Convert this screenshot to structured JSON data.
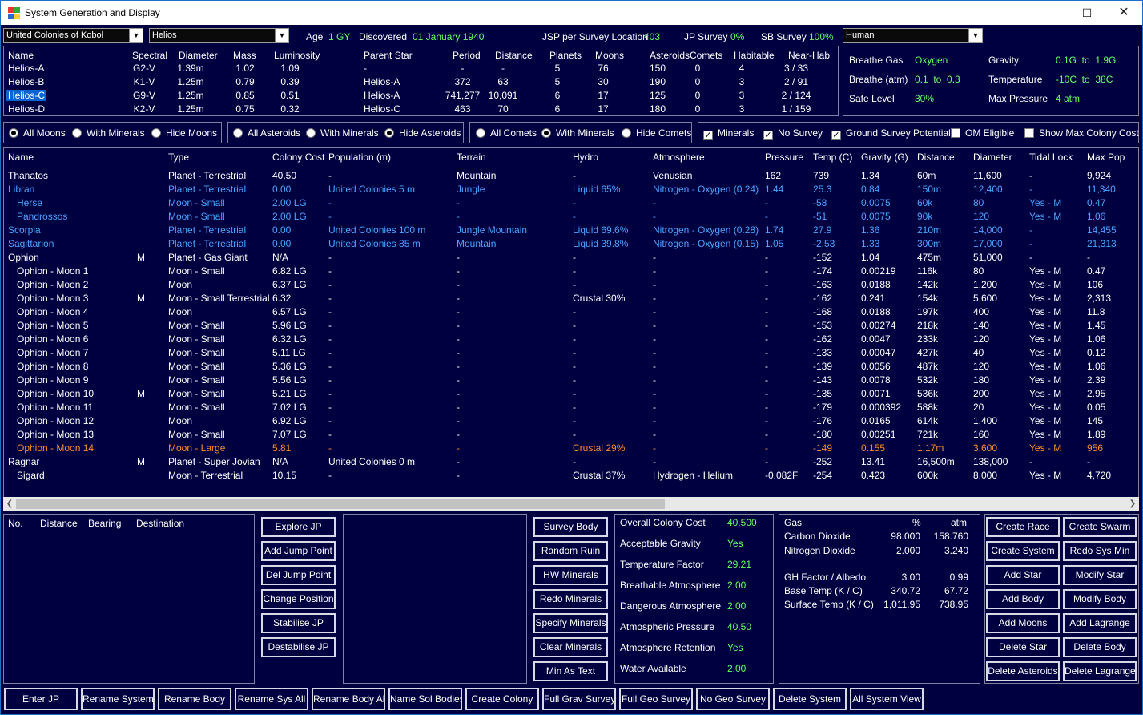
{
  "window": {
    "title": "System Generation and Display"
  },
  "top": {
    "empire": "United Colonies of Kobol",
    "system": "Helios",
    "age_label": "Age",
    "age": "1 GY",
    "discovered_label": "Discovered",
    "discovered": "01 January 1940",
    "jsp_label": "JSP per Survey Location",
    "jsp": "403",
    "jp_label": "JP Survey",
    "jp": "0%",
    "sb_label": "SB Survey",
    "sb": "100%",
    "race": "Human"
  },
  "stars": {
    "headers": [
      "Name",
      "Spectral",
      "Diameter",
      "Mass",
      "Luminosity",
      "Parent Star",
      "Period",
      "Distance",
      "Planets",
      "Moons",
      "Asteroids",
      "Comets",
      "Habitable",
      "Near-Hab"
    ],
    "rows": [
      [
        "Helios-A",
        "G2-V",
        "1.39m",
        "1.02",
        "1.09",
        "-",
        "-",
        "-",
        "5",
        "76",
        "150",
        "0",
        "4",
        "3 / 33"
      ],
      [
        "Helios-B",
        "K1-V",
        "1.25m",
        "0.79",
        "0.39",
        "Helios-A",
        "372",
        "63",
        "5",
        "30",
        "190",
        "0",
        "3",
        "2 / 91"
      ],
      [
        "Helios-C",
        "G9-V",
        "1.25m",
        "0.85",
        "0.51",
        "Helios-A",
        "741,277",
        "10,091",
        "6",
        "17",
        "125",
        "0",
        "3",
        "2 / 124"
      ],
      [
        "Helios-D",
        "K2-V",
        "1.25m",
        "0.75",
        "0.32",
        "Helios-C",
        "463",
        "70",
        "6",
        "17",
        "180",
        "0",
        "3",
        "1 / 159"
      ]
    ],
    "selected": 2
  },
  "env": {
    "breathe_gas_label": "Breathe Gas",
    "breathe_gas": "Oxygen",
    "breathe_atm_label": "Breathe (atm)",
    "breathe_atm": "0.1  to  0.3",
    "safe_label": "Safe Level",
    "safe": "30%",
    "gravity_label": "Gravity",
    "gravity": "0.1G  to  1.9G",
    "temp_label": "Temperature",
    "temp": "-10C  to  38C",
    "maxp_label": "Max Pressure",
    "maxp": "4 atm"
  },
  "filters": {
    "moons": [
      "All Moons",
      "With Minerals",
      "Hide Moons"
    ],
    "asteroids": [
      "All Asteroids",
      "With Minerals",
      "Hide Asteroids"
    ],
    "comets": [
      "All Comets",
      "With Minerals",
      "Hide Comets"
    ],
    "checks": [
      "Minerals",
      "No Survey",
      "Ground Survey Potential",
      "OM Eligible",
      "Show Max Colony Cost"
    ]
  },
  "bodies": {
    "headers": [
      "Name",
      "Type",
      "Colony Cost",
      "Population (m)",
      "Terrain",
      "Hydro",
      "Atmosphere",
      "Pressure",
      "Temp (C)",
      "Gravity (G)",
      "Distance",
      "Diameter",
      "Tidal Lock",
      "Max Pop"
    ],
    "rows": [
      {
        "n": "Thanatos",
        "i": 0,
        "m": "",
        "c": "",
        "v": [
          "Planet - Terrestrial",
          "40.50",
          "-",
          "Mountain",
          "-",
          "Venusian",
          "162",
          "739",
          "1.34",
          "60m",
          "11,600",
          "-",
          "9,924"
        ]
      },
      {
        "n": "Libran",
        "i": 0,
        "m": "",
        "c": "blue",
        "v": [
          "Planet - Terrestrial",
          "0.00",
          "United Colonies 5 m",
          "Jungle",
          "Liquid 65%",
          "Nitrogen - Oxygen (0.24)",
          "1.44",
          "25.3",
          "0.84",
          "150m",
          "12,400",
          "-",
          "11,340"
        ]
      },
      {
        "n": "Herse",
        "i": 1,
        "m": "",
        "c": "blue",
        "v": [
          "Moon - Small",
          "2.00 LG",
          "-",
          "-",
          "-",
          "-",
          "-",
          "-58",
          "0.0075",
          "60k",
          "80",
          "Yes - M",
          "0.47"
        ]
      },
      {
        "n": "Pandrossos",
        "i": 1,
        "m": "",
        "c": "blue",
        "v": [
          "Moon - Small",
          "2.00 LG",
          "-",
          "-",
          "-",
          "-",
          "-",
          "-51",
          "0.0075",
          "90k",
          "120",
          "Yes - M",
          "1.06"
        ]
      },
      {
        "n": "Scorpia",
        "i": 0,
        "m": "",
        "c": "blue",
        "v": [
          "Planet - Terrestrial",
          "0.00",
          "United Colonies 100 m",
          "Jungle Mountain",
          "Liquid 69.6%",
          "Nitrogen - Oxygen (0.28)",
          "1.74",
          "27.9",
          "1.36",
          "210m",
          "14,000",
          "-",
          "14,455"
        ]
      },
      {
        "n": "Sagittarion",
        "i": 0,
        "m": "",
        "c": "blue",
        "v": [
          "Planet - Terrestrial",
          "0.00",
          "United Colonies 85 m",
          "Mountain",
          "Liquid 39.8%",
          "Nitrogen - Oxygen (0.15)",
          "1.05",
          "-2.53",
          "1.33",
          "300m",
          "17,000",
          "-",
          "21,313"
        ]
      },
      {
        "n": "Ophion",
        "i": 0,
        "m": "M",
        "c": "",
        "v": [
          "Planet - Gas Giant",
          "N/A",
          "-",
          "-",
          "-",
          "-",
          "-",
          "-152",
          "1.04",
          "475m",
          "51,000",
          "-",
          "-"
        ]
      },
      {
        "n": "Ophion - Moon 1",
        "i": 1,
        "m": "",
        "c": "",
        "v": [
          "Moon - Small",
          "6.82 LG",
          "-",
          "-",
          "-",
          "-",
          "-",
          "-174",
          "0.00219",
          "116k",
          "80",
          "Yes - M",
          "0.47"
        ]
      },
      {
        "n": "Ophion - Moon 2",
        "i": 1,
        "m": "",
        "c": "",
        "v": [
          "Moon",
          "6.37 LG",
          "-",
          "-",
          "-",
          "-",
          "-",
          "-163",
          "0.0188",
          "142k",
          "1,200",
          "Yes - M",
          "106"
        ]
      },
      {
        "n": "Ophion - Moon 3",
        "i": 1,
        "m": "M",
        "c": "",
        "v": [
          "Moon - Small Terrestrial",
          "6.32",
          "-",
          "-",
          "Crustal 30%",
          "-",
          "-",
          "-162",
          "0.241",
          "154k",
          "5,600",
          "Yes - M",
          "2,313"
        ]
      },
      {
        "n": "Ophion - Moon 4",
        "i": 1,
        "m": "",
        "c": "",
        "v": [
          "Moon",
          "6.57 LG",
          "-",
          "-",
          "-",
          "-",
          "-",
          "-168",
          "0.0188",
          "197k",
          "400",
          "Yes - M",
          "11.8"
        ]
      },
      {
        "n": "Ophion - Moon 5",
        "i": 1,
        "m": "",
        "c": "",
        "v": [
          "Moon - Small",
          "5.96 LG",
          "-",
          "-",
          "-",
          "-",
          "-",
          "-153",
          "0.00274",
          "218k",
          "140",
          "Yes - M",
          "1.45"
        ]
      },
      {
        "n": "Ophion - Moon 6",
        "i": 1,
        "m": "",
        "c": "",
        "v": [
          "Moon - Small",
          "6.32 LG",
          "-",
          "-",
          "-",
          "-",
          "-",
          "-162",
          "0.0047",
          "233k",
          "120",
          "Yes - M",
          "1.06"
        ]
      },
      {
        "n": "Ophion - Moon 7",
        "i": 1,
        "m": "",
        "c": "",
        "v": [
          "Moon - Small",
          "5.11 LG",
          "-",
          "-",
          "-",
          "-",
          "-",
          "-133",
          "0.00047",
          "427k",
          "40",
          "Yes - M",
          "0.12"
        ]
      },
      {
        "n": "Ophion - Moon 8",
        "i": 1,
        "m": "",
        "c": "",
        "v": [
          "Moon - Small",
          "5.36 LG",
          "-",
          "-",
          "-",
          "-",
          "-",
          "-139",
          "0.0056",
          "487k",
          "120",
          "Yes - M",
          "1.06"
        ]
      },
      {
        "n": "Ophion - Moon 9",
        "i": 1,
        "m": "",
        "c": "",
        "v": [
          "Moon - Small",
          "5.56 LG",
          "-",
          "-",
          "-",
          "-",
          "-",
          "-143",
          "0.0078",
          "532k",
          "180",
          "Yes - M",
          "2.39"
        ]
      },
      {
        "n": "Ophion - Moon 10",
        "i": 1,
        "m": "M",
        "c": "",
        "v": [
          "Moon - Small",
          "5.21 LG",
          "-",
          "-",
          "-",
          "-",
          "-",
          "-135",
          "0.0071",
          "536k",
          "200",
          "Yes - M",
          "2.95"
        ]
      },
      {
        "n": "Ophion - Moon 11",
        "i": 1,
        "m": "",
        "c": "",
        "v": [
          "Moon - Small",
          "7.02 LG",
          "-",
          "-",
          "-",
          "-",
          "-",
          "-179",
          "0.000392",
          "588k",
          "20",
          "Yes - M",
          "0.05"
        ]
      },
      {
        "n": "Ophion - Moon 12",
        "i": 1,
        "m": "",
        "c": "",
        "v": [
          "Moon",
          "6.92 LG",
          "-",
          "-",
          "-",
          "-",
          "-",
          "-176",
          "0.0165",
          "614k",
          "1,400",
          "Yes - M",
          "145"
        ]
      },
      {
        "n": "Ophion - Moon 13",
        "i": 1,
        "m": "",
        "c": "",
        "v": [
          "Moon - Small",
          "7.07 LG",
          "-",
          "-",
          "-",
          "-",
          "-",
          "-180",
          "0.00251",
          "721k",
          "160",
          "Yes - M",
          "1.89"
        ]
      },
      {
        "n": "Ophion - Moon 14",
        "i": 1,
        "m": "",
        "c": "orange",
        "v": [
          "Moon - Large",
          "5.81",
          "-",
          "-",
          "Crustal 29%",
          "-",
          "-",
          "-149",
          "0.155",
          "1.17m",
          "3,600",
          "Yes - M",
          "956"
        ]
      },
      {
        "n": "Ragnar",
        "i": 0,
        "m": "M",
        "c": "",
        "v": [
          "Planet - Super Jovian",
          "N/A",
          "United Colonies 0 m",
          "-",
          "-",
          "-",
          "-",
          "-252",
          "13.41",
          "16,500m",
          "138,000",
          "-",
          "-"
        ]
      },
      {
        "n": "Sigard",
        "i": 1,
        "m": "",
        "c": "",
        "v": [
          "Moon - Terrestrial",
          "10.15",
          "-",
          "-",
          "Crustal 37%",
          "Hydrogen - Helium",
          "-0.082F",
          "-254",
          "0.423",
          "600k",
          "8,000",
          "Yes - M",
          "4,720"
        ]
      }
    ]
  },
  "jp_headers": [
    "No.",
    "Distance",
    "Bearing",
    "Destination"
  ],
  "jp_buttons": [
    "Explore JP",
    "Add Jump Point",
    "Del Jump Point",
    "Change Position",
    "Stabilise JP",
    "Destabilise JP"
  ],
  "survey_buttons": [
    "Survey Body",
    "Random Ruin",
    "HW Minerals",
    "Redo Minerals",
    "Specify Minerals",
    "Clear Minerals",
    "Min As Text"
  ],
  "colony": [
    [
      "Overall Colony Cost",
      "40.500"
    ],
    [
      "Acceptable Gravity",
      "Yes"
    ],
    [
      "Temperature Factor",
      "29.21"
    ],
    [
      "Breathable Atmosphere",
      "2.00"
    ],
    [
      "Dangerous Atmosphere",
      "2.00"
    ],
    [
      "Atmospheric Pressure",
      "40.50"
    ],
    [
      "Atmosphere Retention",
      "Yes"
    ],
    [
      "Water Available",
      "2.00"
    ]
  ],
  "gas": {
    "headers": [
      "Gas",
      "%",
      "atm"
    ],
    "rows": [
      [
        "Carbon Dioxide",
        "98.000",
        "158.760"
      ],
      [
        "Nitrogen Dioxide",
        "2.000",
        "3.240"
      ]
    ],
    "gh": [
      "GH Factor / Albedo",
      "3.00",
      "0.99"
    ],
    "base": [
      "Base Temp (K / C)",
      "340.72",
      "67.72"
    ],
    "surf": [
      "Surface Temp (K / C)",
      "1,011.95",
      "738.95"
    ]
  },
  "right_buttons": [
    [
      "Create Race",
      "Create Swarm"
    ],
    [
      "Create System",
      "Redo Sys Min"
    ],
    [
      "Add Star",
      "Modify Star"
    ],
    [
      "Add Body",
      "Modify Body"
    ],
    [
      "Add Moons",
      "Add Lagrange"
    ],
    [
      "Delete Star",
      "Delete Body"
    ],
    [
      "Delete Asteroids",
      "Delete Lagrange"
    ]
  ],
  "bottom_buttons": [
    "Enter JP",
    "Rename System",
    "Rename Body",
    "Rename Sys All",
    "Rename Body All",
    "Name Sol Bodies",
    "Create Colony",
    "Full Grav Survey",
    "Full Geo Survey",
    "No Geo Survey",
    "Delete System",
    "All System View"
  ]
}
